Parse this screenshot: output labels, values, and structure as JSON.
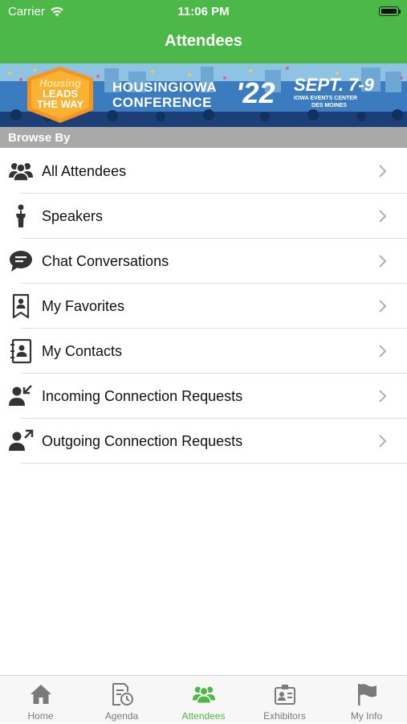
{
  "status_bar": {
    "carrier": "Carrier",
    "time": "11:06 PM"
  },
  "header": {
    "title": "Attendees"
  },
  "banner": {
    "badge_line1": "Housing",
    "badge_line2": "LEADS",
    "badge_line3": "THE WAY",
    "conference_line1": "HOUSINGIOWA",
    "conference_line2": "CONFERENCE",
    "year": "'22",
    "dates": "SEPT. 7-9",
    "venue": "IOWA EVENTS CENTER",
    "city": "DES MOINES"
  },
  "section": {
    "title": "Browse By"
  },
  "list": {
    "items": [
      {
        "label": "All Attendees",
        "icon": "people-group-icon"
      },
      {
        "label": "Speakers",
        "icon": "podium-speaker-icon"
      },
      {
        "label": "Chat Conversations",
        "icon": "chat-bubble-icon"
      },
      {
        "label": "My Favorites",
        "icon": "favorite-bookmark-icon"
      },
      {
        "label": "My Contacts",
        "icon": "contacts-book-icon"
      },
      {
        "label": "Incoming Connection Requests",
        "icon": "person-incoming-icon"
      },
      {
        "label": "Outgoing Connection Requests",
        "icon": "person-outgoing-icon"
      }
    ]
  },
  "tabbar": {
    "tabs": [
      {
        "label": "Home",
        "icon": "home-icon"
      },
      {
        "label": "Agenda",
        "icon": "agenda-calendar-icon"
      },
      {
        "label": "Attendees",
        "icon": "attendees-icon",
        "active": true
      },
      {
        "label": "Exhibitors",
        "icon": "exhibitors-badge-icon"
      },
      {
        "label": "My Info",
        "icon": "flag-icon"
      }
    ]
  },
  "colors": {
    "accent": "#4cb847",
    "section_bg": "#a9a9a9",
    "icon": "#333333",
    "inactive_tab": "#7a7a7a"
  }
}
